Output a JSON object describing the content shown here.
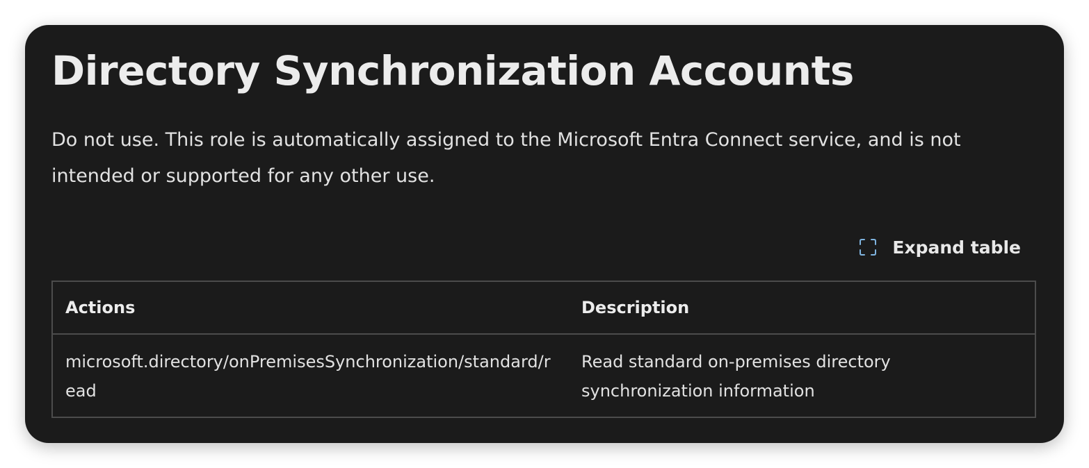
{
  "section": {
    "title": "Directory Synchronization Accounts",
    "description": "Do not use. This role is automatically assigned to the Microsoft Entra Connect service, and is not intended or supported for any other use."
  },
  "toolbar": {
    "expand_label": "Expand table",
    "expand_icon": "expand-icon"
  },
  "table": {
    "headers": {
      "actions": "Actions",
      "description": "Description"
    },
    "rows": [
      {
        "action": "microsoft.directory/onPremisesSynchronization/standard/read",
        "description": "Read standard on-premises directory synchronization information"
      }
    ]
  },
  "colors": {
    "card_background": "#1b1b1b",
    "text": "#e6e6e6",
    "border": "#4c4c4c",
    "icon_accent": "#7fb4e0"
  }
}
